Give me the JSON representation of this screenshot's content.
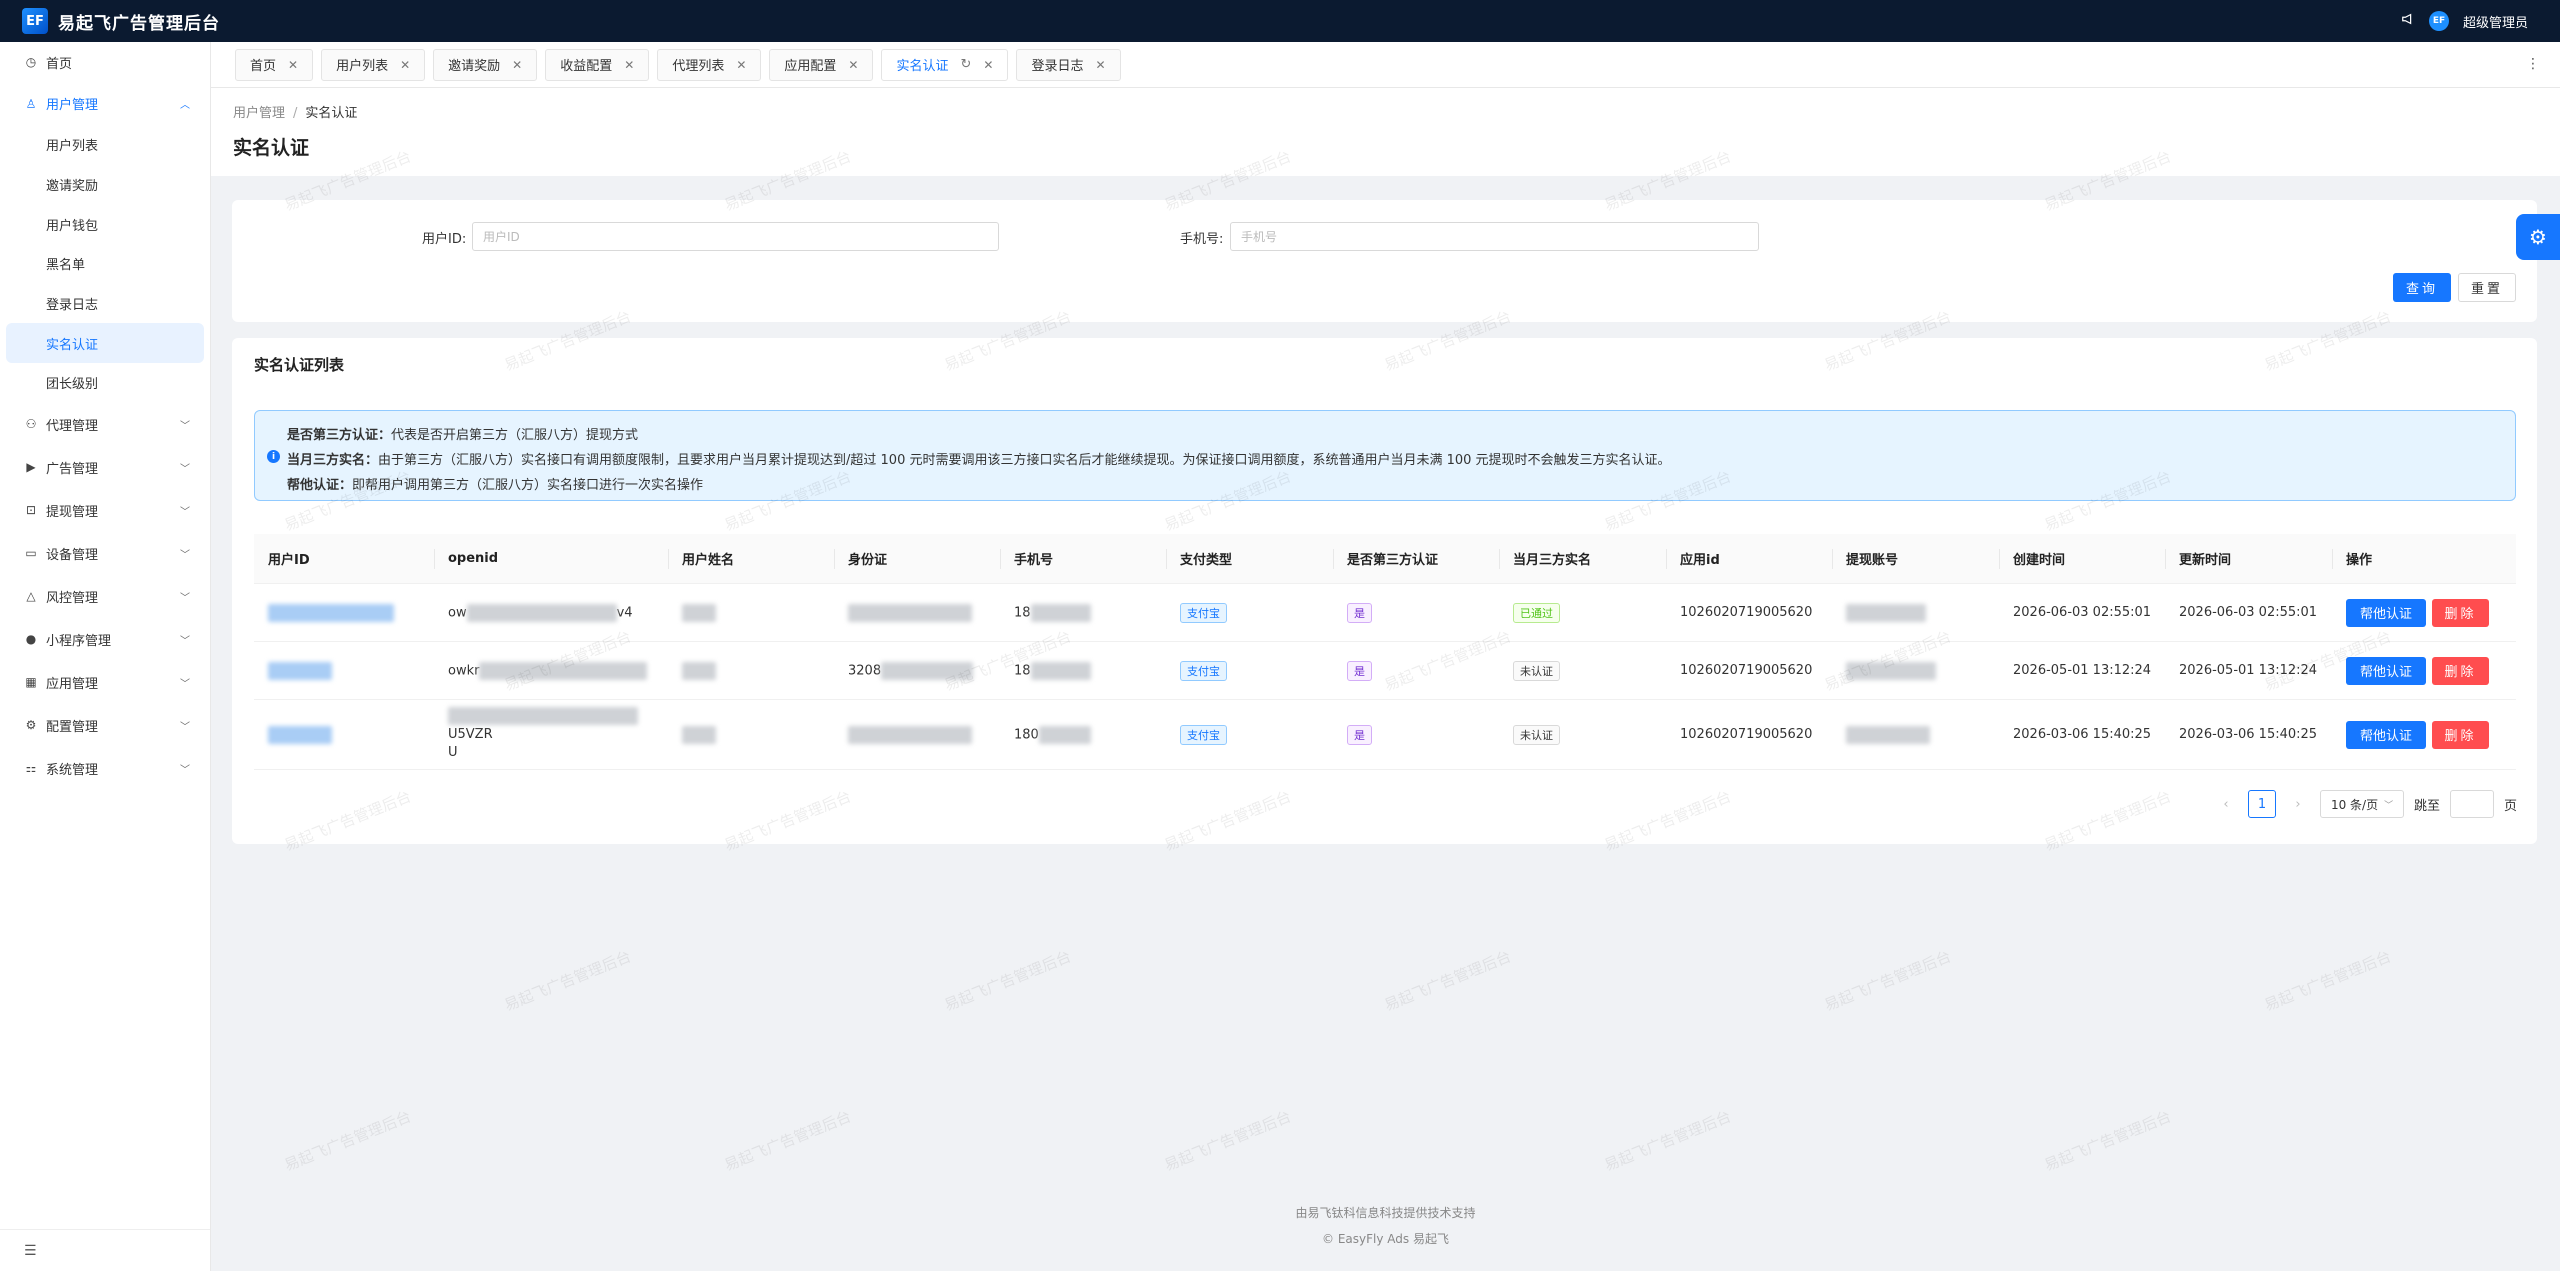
{
  "app": {
    "title": "易起飞广告管理后台",
    "logo_text": "EF",
    "user": "超级管理员",
    "avatar_text": "EF"
  },
  "sidebar": {
    "items": [
      {
        "label": "首页",
        "icon": "dashboard-icon"
      },
      {
        "label": "用户管理",
        "icon": "user-icon",
        "expanded": true
      },
      {
        "label": "代理管理",
        "icon": "agent-icon"
      },
      {
        "label": "广告管理",
        "icon": "ad-icon"
      },
      {
        "label": "提现管理",
        "icon": "withdraw-icon"
      },
      {
        "label": "设备管理",
        "icon": "monitor-icon"
      },
      {
        "label": "风控管理",
        "icon": "warning-icon"
      },
      {
        "label": "小程序管理",
        "icon": "wechat-icon"
      },
      {
        "label": "应用管理",
        "icon": "apps-icon"
      },
      {
        "label": "配置管理",
        "icon": "gear-icon"
      },
      {
        "label": "系统管理",
        "icon": "system-icon"
      }
    ],
    "sub_items": [
      "用户列表",
      "邀请奖励",
      "用户钱包",
      "黑名单",
      "登录日志",
      "实名认证",
      "团长级别"
    ]
  },
  "tabs": [
    "首页",
    "用户列表",
    "邀请奖励",
    "收益配置",
    "代理列表",
    "应用配置",
    "实名认证",
    "登录日志"
  ],
  "breadcrumb": {
    "parent": "用户管理",
    "sep": "/",
    "current": "实名认证"
  },
  "page_title": "实名认证",
  "search": {
    "user_id_label": "用户ID:",
    "user_id_placeholder": "用户ID",
    "phone_label": "手机号:",
    "phone_placeholder": "手机号",
    "query_btn": "查询",
    "reset_btn": "重置"
  },
  "list": {
    "title": "实名认证列表",
    "alert": [
      {
        "key": "是否第三方认证：",
        "text": "代表是否开启第三方（汇服八方）提现方式"
      },
      {
        "key": "当月三方实名：",
        "text": "由于第三方（汇服八方）实名接口有调用额度限制，且要求用户当月累计提现达到/超过 100 元时需要调用该三方接口实名后才能继续提现。为保证接口调用额度，系统普通用户当月未满 100 元提现时不会触发三方实名认证。"
      },
      {
        "key": "帮他认证：",
        "text": "即帮用户调用第三方（汇服八方）实名接口进行一次实名操作"
      }
    ],
    "columns": [
      "用户ID",
      "openid",
      "用户姓名",
      "身份证",
      "手机号",
      "支付类型",
      "是否第三方认证",
      "当月三方实名",
      "应用id",
      "提现账号",
      "创建时间",
      "更新时间",
      "操作"
    ],
    "rows": [
      {
        "openid_pre": "ow",
        "openid_suf": "v4",
        "id_pre": "",
        "phone_pre": "18",
        "pay": "支付宝",
        "third": "是",
        "month_status": "已通过",
        "month_tag": "green",
        "app_id": "1026020719005620",
        "created": "2026-06-03 02:55:01",
        "updated": "2026-06-03 02:55:01"
      },
      {
        "openid_pre": "owkr",
        "openid_suf": "",
        "id_pre": "3208",
        "phone_pre": "18",
        "pay": "支付宝",
        "third": "是",
        "month_status": "未认证",
        "month_tag": "gray",
        "app_id": "1026020719005620",
        "created": "2026-05-01 13:12:24",
        "updated": "2026-05-01 13:12:24"
      },
      {
        "openid_pre": "",
        "openid_suf": "U5VZR",
        "openid_line2": "U",
        "id_pre": "",
        "phone_pre": "180",
        "pay": "支付宝",
        "third": "是",
        "month_status": "未认证",
        "month_tag": "gray",
        "app_id": "1026020719005620",
        "created": "2026-03-06 15:40:25",
        "updated": "2026-03-06 15:40:25"
      }
    ],
    "actions": {
      "help": "帮他认证",
      "delete": "删除"
    }
  },
  "pagination": {
    "current": "1",
    "page_size": "10 条/页",
    "jump_label": "跳至",
    "page_suffix": "页"
  },
  "footer": {
    "line1": "由易飞钛科信息科技提供技术支持",
    "line2": "© EasyFly Ads 易起飞"
  },
  "watermark": "易起飞广告管理后台"
}
